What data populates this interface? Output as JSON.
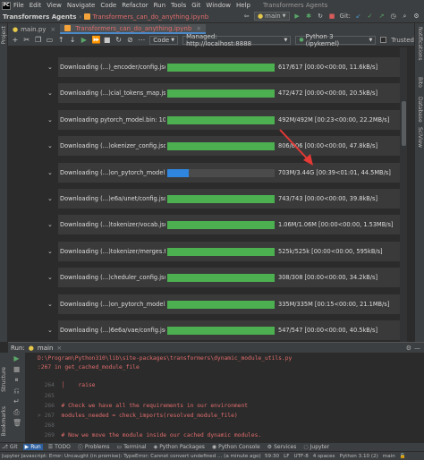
{
  "menubar": {
    "logo_text": "PC",
    "items": [
      "File",
      "Edit",
      "View",
      "Navigate",
      "Code",
      "Refactor",
      "Run",
      "Tools",
      "Git",
      "Window",
      "Help"
    ],
    "window_title": "Transformers Agents"
  },
  "navbar": {
    "project": "Transformers Agents",
    "file": "Transformers_can_do_anything.ipynb",
    "branch": "main",
    "git_label": "Git:"
  },
  "tabs": [
    {
      "label": "main.py",
      "active": false
    },
    {
      "label": "Transformers_can_do_anything.ipynb",
      "active": true
    }
  ],
  "notebook_toolbar": {
    "cell_type": "Code",
    "server": "Managed: http://localhost:8888",
    "kernel": "Python 3 (ipykernel)",
    "trusted": "Trusted"
  },
  "left_strip": {
    "project": "Project"
  },
  "right_strip": {
    "notifications": "Notifications",
    "bito": "Bito",
    "database": "Database",
    "sciview": "SciView"
  },
  "downloads": [
    {
      "label": "Downloading (…)_encoder/config.json: 100%",
      "progress": 1.0,
      "stats": "617/617 [00:00<00:00, 11.6kB/s]",
      "color": "#4caf50"
    },
    {
      "label": "Downloading (…)cial_tokens_map.json: 100%",
      "progress": 1.0,
      "stats": "472/472 [00:00<00:00, 20.5kB/s]",
      "color": "#4caf50"
    },
    {
      "label": "Downloading pytorch_model.bin: 100%",
      "progress": 1.0,
      "stats": "492M/492M [00:23<00:00, 22.2MB/s]",
      "color": "#4caf50"
    },
    {
      "label": "Downloading (…)okenizer_config.json: 100%",
      "progress": 1.0,
      "stats": "806/806 [00:00<00:00, 47.8kB/s]",
      "color": "#4caf50"
    },
    {
      "label": "Downloading (…)on_pytorch_model.bin: 20%",
      "progress": 0.2,
      "stats": "703M/3.44G [00:39<01:01, 44.5MB/s]",
      "color": "#2e86de"
    },
    {
      "label": "Downloading (…)e6a/unet/config.json: 100%",
      "progress": 1.0,
      "stats": "743/743 [00:00<00:00, 39.8kB/s]",
      "color": "#4caf50"
    },
    {
      "label": "Downloading (…)tokenizer/vocab.json: 100%",
      "progress": 1.0,
      "stats": "1.06M/1.06M [00:00<00:00, 1.53MB/s]",
      "color": "#4caf50"
    },
    {
      "label": "Downloading (…)tokenizer/merges.txt: 100%",
      "progress": 1.0,
      "stats": "525k/525k [00:00<00:00, 595kB/s]",
      "color": "#4caf50"
    },
    {
      "label": "Downloading (…)cheduler_config.json: 100%",
      "progress": 1.0,
      "stats": "308/308 [00:00<00:00, 34.2kB/s]",
      "color": "#4caf50"
    },
    {
      "label": "Downloading (…)on_pytorch_model.bin: 100%",
      "progress": 1.0,
      "stats": "335M/335M [00:15<00:00, 21.1MB/s]",
      "color": "#4caf50"
    },
    {
      "label": "Downloading (…)6e6a/vae/config.json: 100%",
      "progress": 1.0,
      "stats": "547/547 [00:00<00:00, 40.5kB/s]",
      "color": "#4caf50"
    }
  ],
  "run_panel": {
    "run_label": "Run:",
    "config": "main",
    "console_lines": [
      {
        "gutter": "",
        "text": "D:\\Program\\Python310\\lib\\site-packages\\transformers\\dynamic_module_utils.py"
      },
      {
        "gutter": "",
        "text": ":267 in get_cached_module_file"
      },
      {
        "gutter": "",
        "text": ""
      },
      {
        "gutter": "  264",
        "text": "  │    raise"
      },
      {
        "gutter": "  265",
        "text": ""
      },
      {
        "gutter": "  266",
        "text": "  # Check we have all the requirements in our environment"
      },
      {
        "gutter": "> 267",
        "text": "  modules_needed = check_imports(resolved_module_file)"
      },
      {
        "gutter": "  268",
        "text": ""
      },
      {
        "gutter": "  269",
        "text": "  # Now we move the module inside our cached dynamic modules."
      }
    ]
  },
  "bottom_tabs": [
    "Git",
    "Run",
    "TODO",
    "Problems",
    "Terminal",
    "Python Packages",
    "Python Console",
    "Services",
    "Jupyter"
  ],
  "status_bar": {
    "message": "Jupyter Javascript: Error: Uncaught (in promise): TypeError: Cannot convert undefined ... (a minute ago)",
    "position": "59:30",
    "line_sep": "LF",
    "encoding": "UTF-8",
    "indent": "4 spaces",
    "interpreter": "Python 3.10 (2)",
    "branch": "main"
  }
}
